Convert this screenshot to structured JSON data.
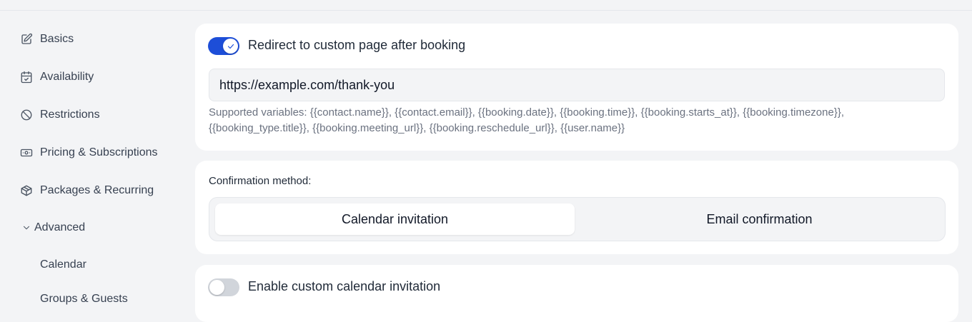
{
  "sidebar": {
    "items": [
      {
        "label": "Basics",
        "icon": "edit-icon"
      },
      {
        "label": "Availability",
        "icon": "calendar-check-icon"
      },
      {
        "label": "Restrictions",
        "icon": "ban-icon"
      },
      {
        "label": "Pricing & Subscriptions",
        "icon": "banknote-icon"
      },
      {
        "label": "Packages & Recurring",
        "icon": "package-icon"
      }
    ],
    "advanced": {
      "label": "Advanced",
      "icon": "chevron-down-icon",
      "expanded": true
    },
    "sub_items": [
      {
        "label": "Calendar"
      },
      {
        "label": "Groups & Guests"
      }
    ]
  },
  "redirect": {
    "toggle_on": true,
    "label": "Redirect to custom page after booking",
    "url_value": "https://example.com/thank-you",
    "help_text": "Supported variables: {{contact.name}}, {{contact.email}}, {{booking.date}}, {{booking.time}}, {{booking.starts_at}}, {{booking.timezone}}, {{booking_type.title}}, {{booking.meeting_url}}, {{booking.reschedule_url}}, {{user.name}}"
  },
  "confirmation": {
    "label": "Confirmation method:",
    "options": [
      {
        "label": "Calendar invitation",
        "selected": true
      },
      {
        "label": "Email confirmation",
        "selected": false
      }
    ]
  },
  "custom_invitation": {
    "toggle_on": false,
    "label": "Enable custom calendar invitation"
  },
  "colors": {
    "accent": "#1d4ed8",
    "background": "#f3f4f6",
    "card": "#ffffff"
  }
}
